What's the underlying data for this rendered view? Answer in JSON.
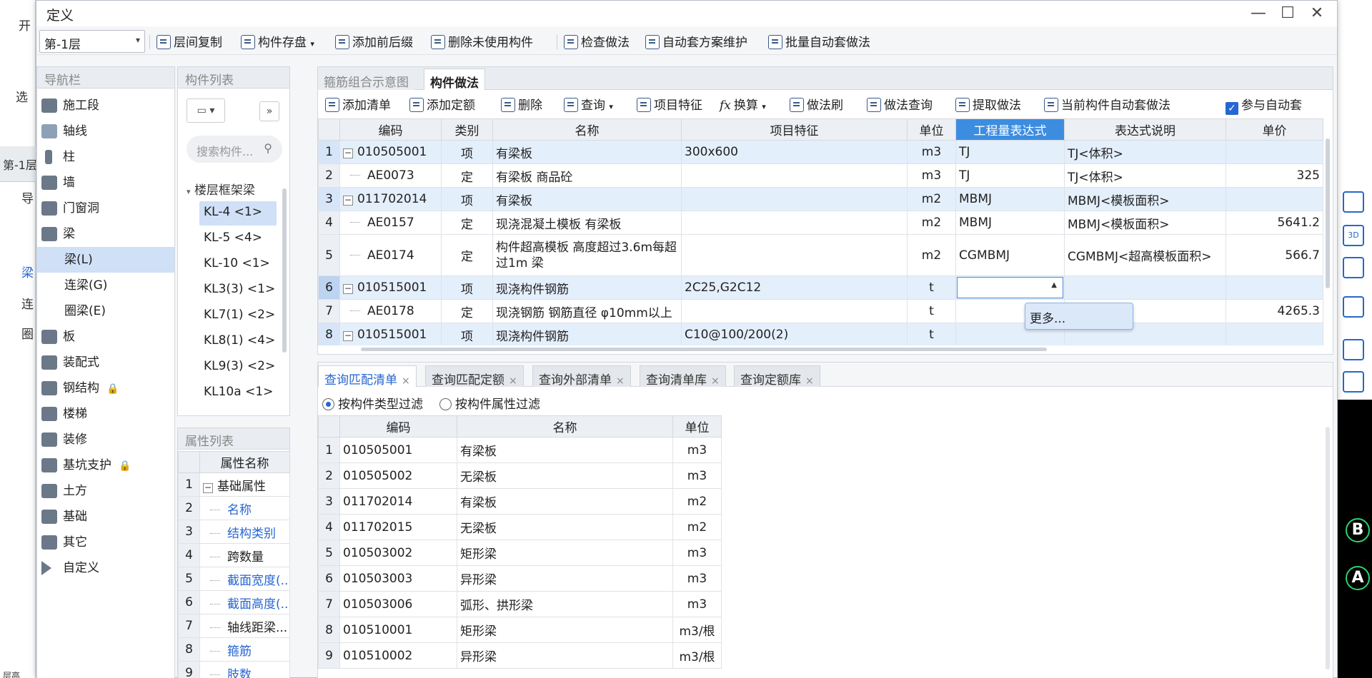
{
  "background": {
    "left_labels": [
      "开",
      "选",
      "第-1层",
      "导",
      "梁",
      "连",
      "圈"
    ],
    "right_axis_labels": [
      "B",
      "A"
    ],
    "right_icon_label": "3D",
    "bottom_text": "层高"
  },
  "dialog": {
    "title": "定义",
    "minimize": "—",
    "maximize": "☐",
    "close": "✕"
  },
  "toolbar": {
    "floor_value": "第-1层",
    "items": [
      "层间复制",
      "构件存盘",
      "添加前后缀",
      "删除未使用构件",
      "检查做法",
      "自动套方案维护",
      "批量自动套做法"
    ]
  },
  "nav": {
    "header": "导航栏",
    "items": [
      {
        "label": "施工段"
      },
      {
        "label": "轴线"
      },
      {
        "label": "柱"
      },
      {
        "label": "墙"
      },
      {
        "label": "门窗洞"
      },
      {
        "label": "梁"
      },
      {
        "label": "梁(L)"
      },
      {
        "label": "连梁(G)"
      },
      {
        "label": "圈梁(E)"
      },
      {
        "label": "板"
      },
      {
        "label": "装配式"
      },
      {
        "label": "钢结构"
      },
      {
        "label": "楼梯"
      },
      {
        "label": "装修"
      },
      {
        "label": "基坑支护"
      },
      {
        "label": "土方"
      },
      {
        "label": "基础"
      },
      {
        "label": "其它"
      },
      {
        "label": "自定义"
      }
    ]
  },
  "component_list": {
    "header": "构件列表",
    "search_placeholder": "搜索构件...",
    "group": "楼层框架梁",
    "items": [
      "KL-4 <1>",
      "KL-5 <4>",
      "KL-10 <1>",
      "KL3(3) <1>",
      "KL7(1) <2>",
      "KL8(1) <4>",
      "KL9(3) <2>",
      "KL10a <1>"
    ]
  },
  "property_list": {
    "header": "属性列表",
    "column": "属性名称",
    "rows": [
      "基础属性",
      "名称",
      "结构类别",
      "跨数量",
      "截面宽度(...",
      "截面高度(...",
      "轴线距梁...",
      "箍筋",
      "肢数"
    ]
  },
  "main_tabs": [
    "箍筋组合示意图",
    "构件做法"
  ],
  "method_toolbar": [
    "添加清单",
    "添加定额",
    "删除",
    "查询",
    "项目特征",
    "换算",
    "做法刷",
    "做法查询",
    "提取做法",
    "当前构件自动套做法",
    "参与自动套"
  ],
  "method_table": {
    "columns": [
      "编码",
      "类别",
      "名称",
      "项目特征",
      "单位",
      "工程量表达式",
      "表达式说明",
      "单价"
    ],
    "rows": [
      {
        "n": "1",
        "code": "010505001",
        "type": "项",
        "name": "有梁板",
        "feature": "300x600",
        "unit": "m3",
        "expr": "TJ",
        "desc": "TJ<体积>",
        "price": ""
      },
      {
        "n": "2",
        "code": "AE0073",
        "type": "定",
        "name": "有梁板 商品砼",
        "feature": "",
        "unit": "m3",
        "expr": "TJ",
        "desc": "TJ<体积>",
        "price": "325"
      },
      {
        "n": "3",
        "code": "011702014",
        "type": "项",
        "name": "有梁板",
        "feature": "",
        "unit": "m2",
        "expr": "MBMJ",
        "desc": "MBMJ<模板面积>",
        "price": ""
      },
      {
        "n": "4",
        "code": "AE0157",
        "type": "定",
        "name": "现浇混凝土模板 有梁板",
        "feature": "",
        "unit": "m2",
        "expr": "MBMJ",
        "desc": "MBMJ<模板面积>",
        "price": "5641.2"
      },
      {
        "n": "5",
        "code": "AE0174",
        "type": "定",
        "name": "构件超高模板 高度超过3.6m每超过1m 梁",
        "feature": "",
        "unit": "m2",
        "expr": "CGMBMJ",
        "desc": "CGMBMJ<超高模板面积>",
        "price": "566.7"
      },
      {
        "n": "6",
        "code": "010515001",
        "type": "项",
        "name": "现浇构件钢筋",
        "feature": "2C25,G2C12",
        "unit": "t",
        "expr": "",
        "desc": "",
        "price": ""
      },
      {
        "n": "7",
        "code": "AE0178",
        "type": "定",
        "name": "现浇钢筋 钢筋直径 φ10mm以上",
        "feature": "",
        "unit": "t",
        "expr": "",
        "desc": "",
        "price": "4265.3"
      },
      {
        "n": "8",
        "code": "010515001",
        "type": "项",
        "name": "现浇构件钢筋",
        "feature": "C10@100/200(2)",
        "unit": "t",
        "expr": "",
        "desc": "",
        "price": ""
      }
    ],
    "dropdown_option": "更多..."
  },
  "query_tabs": [
    "查询匹配清单",
    "查询匹配定额",
    "查询外部清单",
    "查询清单库",
    "查询定额库"
  ],
  "filters": [
    "按构件类型过滤",
    "按构件属性过滤"
  ],
  "query_table": {
    "columns": [
      "编码",
      "名称",
      "单位"
    ],
    "rows": [
      {
        "n": "1",
        "code": "010505001",
        "name": "有梁板",
        "unit": "m3"
      },
      {
        "n": "2",
        "code": "010505002",
        "name": "无梁板",
        "unit": "m3"
      },
      {
        "n": "3",
        "code": "011702014",
        "name": "有梁板",
        "unit": "m2"
      },
      {
        "n": "4",
        "code": "011702015",
        "name": "无梁板",
        "unit": "m2"
      },
      {
        "n": "5",
        "code": "010503002",
        "name": "矩形梁",
        "unit": "m3"
      },
      {
        "n": "6",
        "code": "010503003",
        "name": "异形梁",
        "unit": "m3"
      },
      {
        "n": "7",
        "code": "010503006",
        "name": "弧形、拱形梁",
        "unit": "m3"
      },
      {
        "n": "8",
        "code": "010510001",
        "name": "矩形梁",
        "unit": "m3/根"
      },
      {
        "n": "9",
        "code": "010510002",
        "name": "异形梁",
        "unit": "m3/根"
      }
    ]
  }
}
